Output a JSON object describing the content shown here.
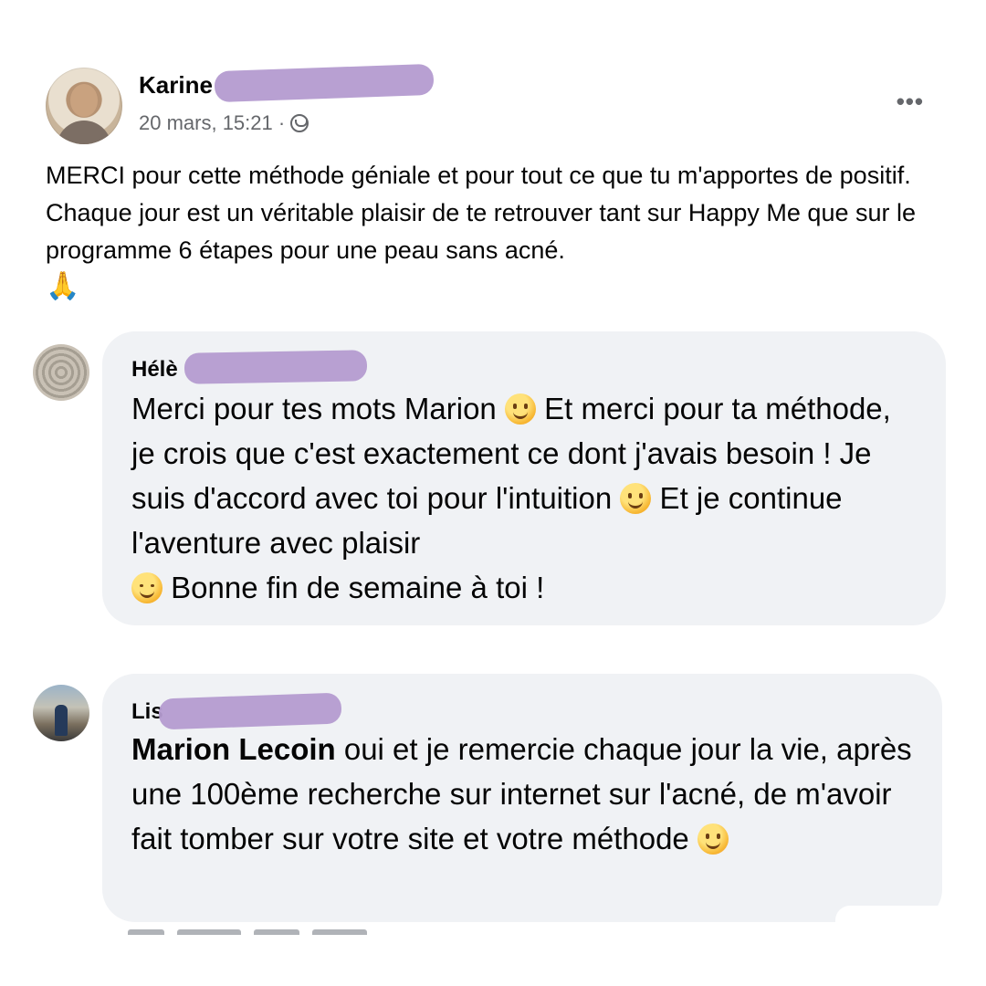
{
  "post": {
    "author": "Karine",
    "meta": "20 mars, 15:21 ·",
    "audience_icon": "friends-icon",
    "more_icon": "•••",
    "text": "MERCI pour cette méthode géniale et pour tout ce que tu m'apportes de positif. Chaque jour est un véritable plaisir de te retrouver tant sur Happy Me que sur le programme 6 étapes pour une peau sans acné.",
    "emoji": "🙏"
  },
  "comments": [
    {
      "name": "Hélè",
      "text_parts": [
        "Merci pour tes mots Marion ",
        " Et merci pour ta méthode, je crois que c'est exactement ce dont j'avais besoin ! Je suis d'accord avec toi pour l'intuition ",
        " Et je continue l'aventure avec plaisir ",
        " Bonne fin de semaine à toi !"
      ]
    },
    {
      "name": "Lis",
      "mention": "Marion Lecoin",
      "text": " oui et je remercie chaque jour la vie, après une 100ème recherche sur internet sur l'acné, de m'avoir fait tomber sur votre site et votre méthode "
    }
  ],
  "colors": {
    "bubble": "#f0f2f5",
    "redaction": "#b49bd0",
    "meta_text": "#65676b"
  }
}
